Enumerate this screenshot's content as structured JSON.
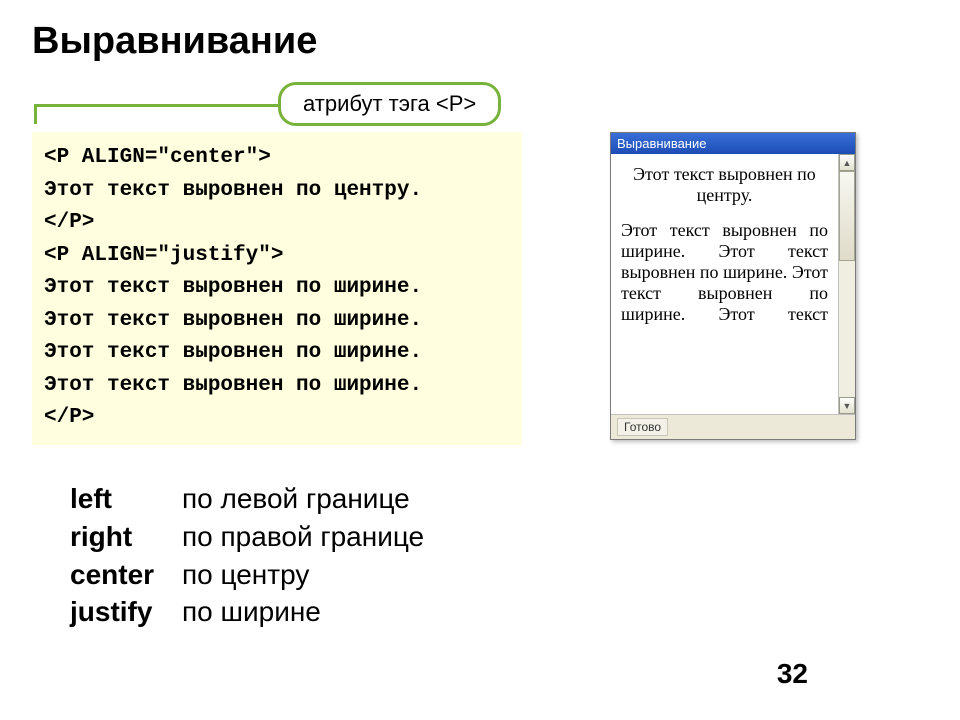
{
  "title": "Выравнивание",
  "pill_label": "атрибут тэга <P>",
  "code": {
    "l1": "<P ALIGN=\"center\">",
    "l2": "Этот текст выровнен по центру.",
    "l3": "</P>",
    "l4": "<P ALIGN=\"justify\">",
    "l5": "Этот текст выровнен по ширине.",
    "l6": "Этот текст выровнен по ширине.",
    "l7": "Этот текст выровнен по ширине.",
    "l8": "Этот текст выровнен по ширине.",
    "l9": "</P>"
  },
  "preview": {
    "window_title": "Выравнивание",
    "centered_text": "Этот текст выровнен по центру.",
    "justified_text": "Этот текст выровнен по ширине. Этот текст выровнен по ширине. Этот текст выровнен по ширине. Этот текст",
    "status": "Готово"
  },
  "defs": [
    {
      "term": "left",
      "desc": "по левой границе"
    },
    {
      "term": "right",
      "desc": "по правой границе"
    },
    {
      "term": "center",
      "desc": "по центру"
    },
    {
      "term": "justify",
      "desc": "по ширине"
    }
  ],
  "page_number": "32"
}
